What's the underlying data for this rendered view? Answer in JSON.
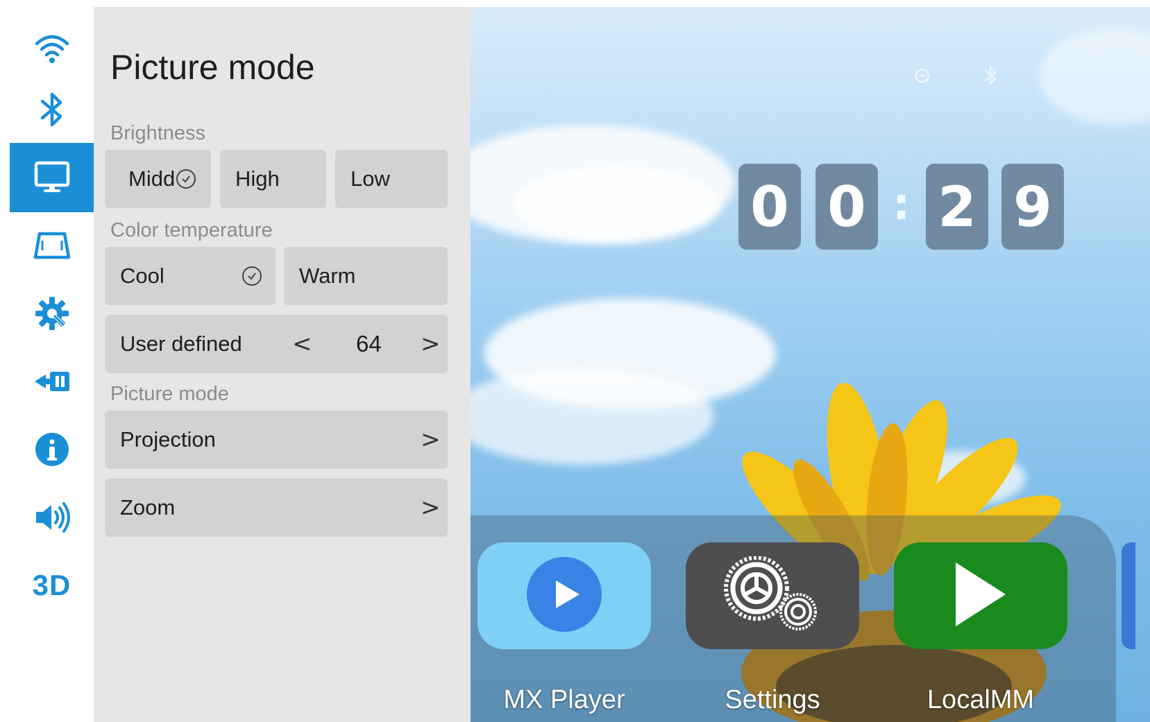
{
  "sidebar": {
    "items": [
      {
        "icon": "wifi-icon",
        "active": false
      },
      {
        "icon": "bluetooth-icon",
        "active": false
      },
      {
        "icon": "display-icon",
        "active": true
      },
      {
        "icon": "keystone-icon",
        "active": false
      },
      {
        "icon": "gear-wrench-icon",
        "active": false
      },
      {
        "icon": "input-source-icon",
        "active": false
      },
      {
        "icon": "info-icon",
        "active": false
      },
      {
        "icon": "speaker-icon",
        "active": false
      },
      {
        "icon": "3d-icon",
        "label": "3D",
        "active": false
      }
    ],
    "accent": "#1a8fd6"
  },
  "panel": {
    "title": "Picture mode",
    "brightness": {
      "label": "Brightness",
      "options": [
        "Midd",
        "High",
        "Low"
      ],
      "selected": "Midd"
    },
    "color_temperature": {
      "label": "Color temperature",
      "options": [
        "Cool",
        "Warm"
      ],
      "selected": "Cool",
      "user_defined": {
        "label": "User defined",
        "value": "64",
        "prev": "<",
        "next": ">"
      }
    },
    "picture_mode": {
      "label": "Picture mode",
      "items": [
        {
          "label": "Projection",
          "chevron": ">"
        },
        {
          "label": "Zoom",
          "chevron": ">"
        }
      ]
    }
  },
  "home": {
    "clock": {
      "d1": "0",
      "d2": "0",
      "sep": ":",
      "d3": "2",
      "d4": "9"
    },
    "apps": [
      {
        "label": "MX Player",
        "color": "#7fd0f7"
      },
      {
        "label": "Settings",
        "color": "#4e4e4e"
      },
      {
        "label": "LocalMM",
        "color": "#1a8a1f"
      }
    ]
  }
}
